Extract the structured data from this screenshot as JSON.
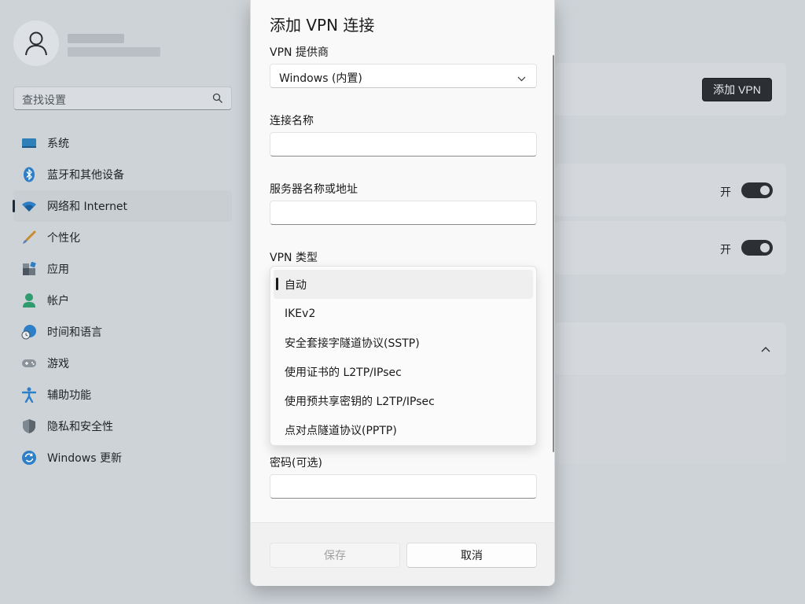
{
  "sidebar": {
    "search_placeholder": "查找设置",
    "items": [
      {
        "label": "系统",
        "icon": "monitor-icon"
      },
      {
        "label": "蓝牙和其他设备",
        "icon": "bluetooth-icon"
      },
      {
        "label": "网络和 Internet",
        "icon": "wifi-icon",
        "active": true
      },
      {
        "label": "个性化",
        "icon": "brush-icon"
      },
      {
        "label": "应用",
        "icon": "apps-icon"
      },
      {
        "label": "帐户",
        "icon": "person-icon"
      },
      {
        "label": "时间和语言",
        "icon": "globe-clock-icon"
      },
      {
        "label": "游戏",
        "icon": "gamepad-icon"
      },
      {
        "label": "辅助功能",
        "icon": "accessibility-icon"
      },
      {
        "label": "隐私和安全性",
        "icon": "shield-icon"
      },
      {
        "label": "Windows 更新",
        "icon": "update-icon"
      }
    ]
  },
  "main": {
    "add_vpn_label": "添加 VPN",
    "toggle1_label": "开",
    "toggle2_label": "开"
  },
  "dialog": {
    "title": "添加 VPN 连接",
    "provider_label": "VPN 提供商",
    "provider_value": "Windows (内置)",
    "connection_name_label": "连接名称",
    "server_label": "服务器名称或地址",
    "vpn_type_label": "VPN 类型",
    "vpn_type_options": [
      "自动",
      "IKEv2",
      "安全套接字隧道协议(SSTP)",
      "使用证书的 L2TP/IPsec",
      "使用预共享密钥的 L2TP/IPsec",
      "点对点隧道协议(PPTP)"
    ],
    "vpn_type_selected_index": 0,
    "password_label": "密码(可选)",
    "save_label": "保存",
    "cancel_label": "取消"
  },
  "colors": {
    "accent_dark": "#2b2f33",
    "dialog_bg": "#f9f9f9",
    "backdrop": "#ced3d8"
  }
}
